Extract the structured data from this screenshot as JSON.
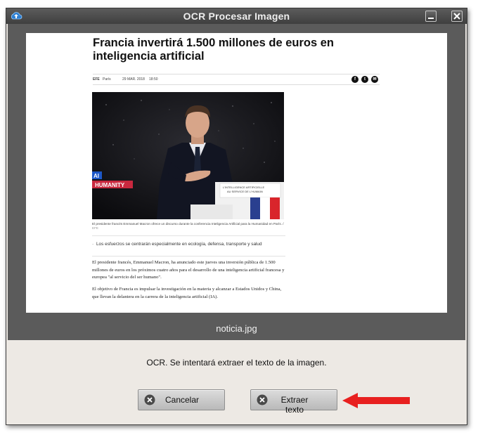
{
  "window": {
    "title": "OCR Procesar Imagen"
  },
  "article": {
    "headline": "Francia invertirá 1.500 millones de euros en inteligencia artificial",
    "source": "EFE",
    "city": "París",
    "date": "29 MAR. 2018",
    "time": "18:50",
    "photo_banner_1": "AI",
    "photo_banner_2": "HUMANITY",
    "podium_sign_1": "L'INTELLIGENCE ARTIFICIELLE",
    "podium_sign_2": "AU SERVICE DE L'HUMAIN",
    "caption": "El presidente francés Emmanuel Macron ofrece un discurso durante la conferencia Inteligencia Artificial para la Humanidad en París.",
    "caption_credit": "EFE",
    "bullet": "Los esfuerzos se centrarán especialmente en ecología, defensa, transporte y salud",
    "paragraph_1": "El presidente francés, Emmanuel Macron, ha anunciado este jueves una inversión pública de 1.500 millones de euros en los próximos cuatro años para el desarrollo de una inteligencia artificial francesa y europea \"al servicio del ser humano\".",
    "paragraph_2": "El objetivo de Francia es impulsar la investigación en la materia y alcanzar a Estados Unidos y China, que llevan la delantera en la carrera de la inteligencia artificial (IA)."
  },
  "preview": {
    "filename": "noticia.jpg"
  },
  "dialog": {
    "message": "OCR. Se intentará extraer el texto de la imagen.",
    "cancel_label": "Cancelar",
    "extract_label": "Extraer texto"
  },
  "icons": {
    "app": "cloud-upload-icon",
    "minimize": "minimize-icon",
    "close": "close-icon",
    "cancel": "x-circle-icon",
    "extract": "x-circle-icon",
    "annotation": "red-arrow"
  },
  "colors": {
    "titlebar": "#4a4a4a",
    "preview_bg": "#5b5b5b",
    "dialog_bg": "#ede9e4",
    "arrow": "#e8201f"
  }
}
